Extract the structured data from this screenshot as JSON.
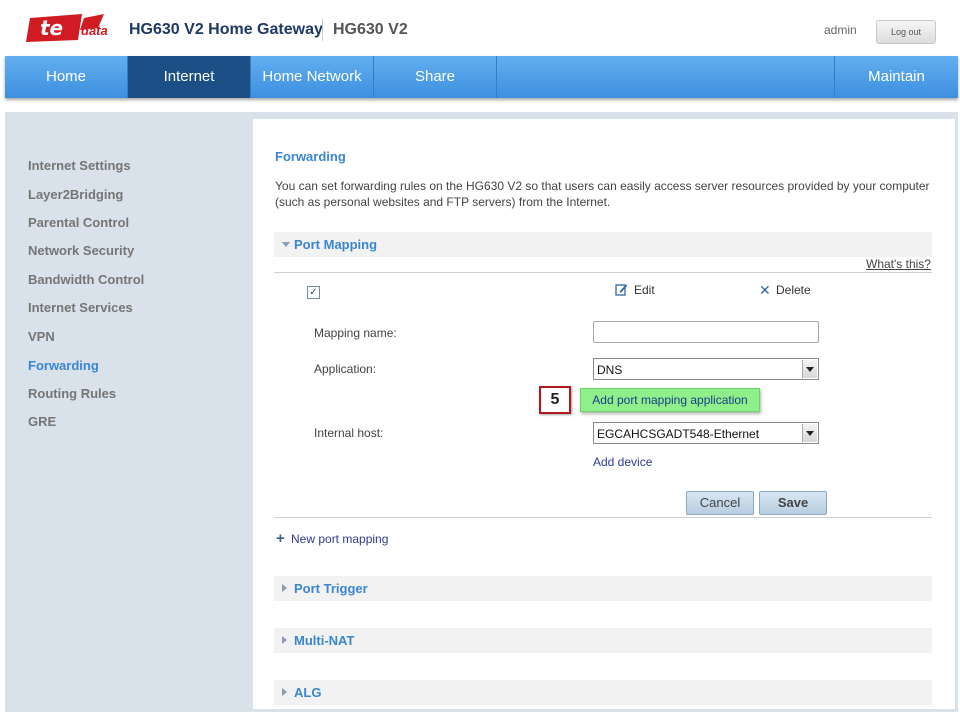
{
  "header": {
    "logo_text": "te",
    "logo_subtext": "data",
    "product_title": "HG630 V2 Home Gateway",
    "product_model": "HG630 V2",
    "user": "admin",
    "logout_label": "Log out"
  },
  "nav": {
    "items": [
      "Home",
      "Internet",
      "Home Network",
      "Share"
    ],
    "active": "Internet",
    "right_item": "Maintain"
  },
  "sidebar": {
    "items": [
      "Internet Settings",
      "Layer2Bridging",
      "Parental Control",
      "Network Security",
      "Bandwidth Control",
      "Internet Services",
      "VPN",
      "Forwarding",
      "Routing Rules",
      "GRE"
    ],
    "active": "Forwarding"
  },
  "main": {
    "section_title": "Forwarding",
    "description": "You can set forwarding rules on the HG630 V2 so that users can easily access server resources provided by your computer (such as personal websites and FTP servers) from the Internet.",
    "port_mapping": {
      "title": "Port Mapping",
      "expanded": true,
      "whats_this": "What's this?",
      "checkbox_checked": true,
      "edit_label": "Edit",
      "delete_label": "Delete",
      "mapping_name_label": "Mapping name:",
      "mapping_name_value": "",
      "application_label": "Application:",
      "application_value": "DNS",
      "step_number": "5",
      "add_app_label": "Add port mapping application",
      "internal_host_label": "Internal host:",
      "internal_host_value": "EGCAHCSGADT548-Ethernet",
      "add_device_label": "Add device",
      "cancel_label": "Cancel",
      "save_label": "Save",
      "new_mapping_label": "New port mapping"
    },
    "collapsed_sections": [
      "Port Trigger",
      "Multi-NAT",
      "ALG"
    ]
  },
  "colors": {
    "nav_blue": "#4a9be6",
    "nav_active": "#1b4f86",
    "accent_blue": "#3a86d1",
    "highlight_green": "#8ff08a",
    "badge_red": "#b3181d",
    "brand_red": "#d11b22"
  }
}
